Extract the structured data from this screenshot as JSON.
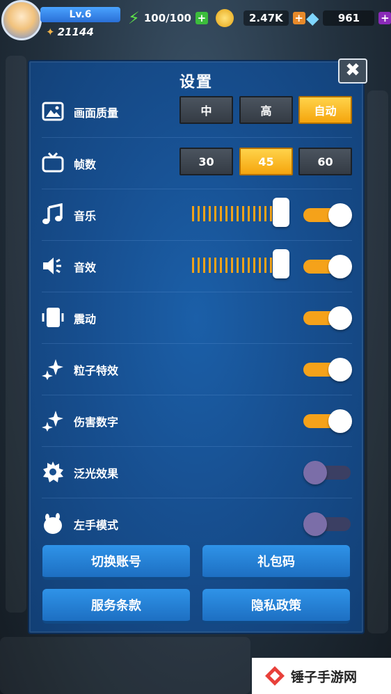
{
  "hud": {
    "level": "Lv.6",
    "power": "21144",
    "energy": "100/100",
    "gold": "2.47K",
    "gems": "961"
  },
  "settings": {
    "title": "设置",
    "graphics": {
      "label": "画面质量",
      "options": [
        "中",
        "高",
        "自动"
      ],
      "selected": "自动"
    },
    "fps": {
      "label": "帧数",
      "options": [
        "30",
        "45",
        "60"
      ],
      "selected": "45"
    },
    "music": {
      "label": "音乐",
      "level": 1.0,
      "enabled": true
    },
    "sfx": {
      "label": "音效",
      "level": 1.0,
      "enabled": true
    },
    "vibration": {
      "label": "震动",
      "enabled": true
    },
    "particles": {
      "label": "粒子特效",
      "enabled": true
    },
    "damage_numbers": {
      "label": "伤害数字",
      "enabled": true
    },
    "bloom": {
      "label": "泛光效果",
      "enabled": false
    },
    "left_hand": {
      "label": "左手模式",
      "enabled": false
    },
    "buttons": {
      "switch_account": "切换账号",
      "gift_code": "礼包码",
      "terms": "服务条款",
      "privacy": "隐私政策"
    }
  },
  "watermark": "锤子手游网",
  "colors": {
    "accent": "#f5a21a",
    "panel": "#174f90",
    "button": "#2f93e8"
  }
}
